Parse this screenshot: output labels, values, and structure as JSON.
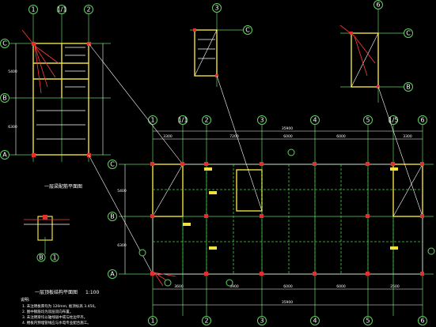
{
  "axis_labels": {
    "a": "A",
    "b": "B",
    "c": "C",
    "n1": "1",
    "n1a": "1/1",
    "n2": "2",
    "n3": "3",
    "n4": "4",
    "n5": "5",
    "n5a": "1/5",
    "n6": "6"
  },
  "dims": {
    "total_top": "35900",
    "total_bottom": "35900",
    "seg_a": "3300",
    "seg_b": "3600",
    "seg_c": "3900",
    "seg_d": "7200",
    "seg_e": "6000",
    "seg_f": "2500",
    "h1": "5400",
    "h2": "6300"
  },
  "titles": {
    "stair_plan": "一层梁配筋平面图",
    "main_plan": "一层顶板结构平面图",
    "main_scale": "1:100",
    "notes_head": "说明:"
  },
  "notes": [
    "1. 未注明板厚均为 120mm, 板顶标高 3.450。",
    "2. 图中钢筋均为双层双向布置。",
    "3. 未注明梁均以轴线居中或与柱边平齐。",
    "4. 楼板内预埋管线应与水电专业配合施工。"
  ],
  "colors": {
    "axis": "#5fd35f",
    "beam": "#f0e040",
    "rebar": "#ff3b3b",
    "line": "#ffffff",
    "background": "#000000"
  }
}
